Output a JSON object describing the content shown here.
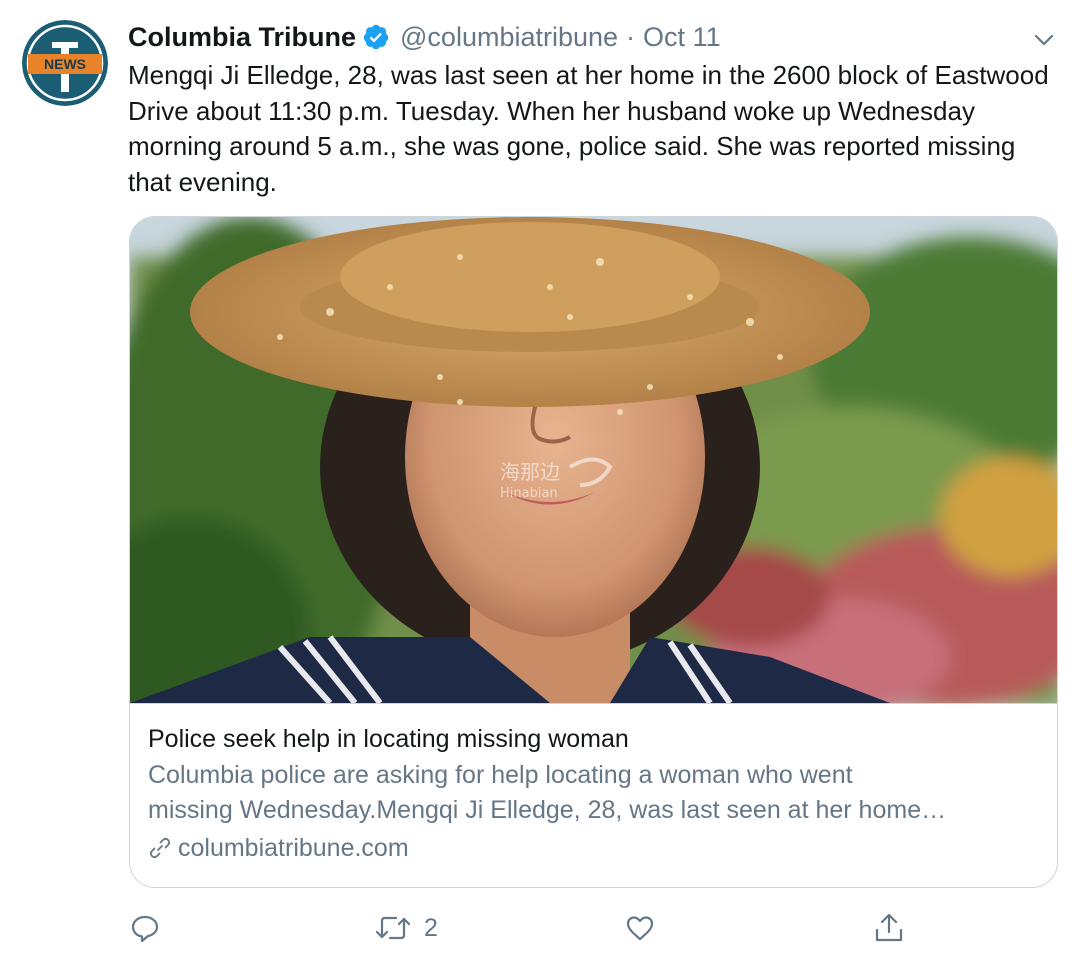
{
  "account": {
    "display_name": "Columbia Tribune",
    "handle": "@columbiatribune",
    "separator": "·",
    "date": "Oct 11",
    "avatar_text": "NEWS",
    "avatar_letter": "T"
  },
  "tweet": {
    "text": "Mengqi Ji Elledge, 28, was last seen at her home in the 2600 block of Eastwood Drive about 11:30 p.m. Tuesday. When her husband woke up Wednesday morning around 5 a.m., she was gone, police said. She was reported missing that evening."
  },
  "card": {
    "title": "Police seek help in locating missing woman",
    "description_line1": "Columbia police are asking for help locating a woman who went",
    "description_line2": "missing Wednesday.Mengqi Ji Elledge, 28, was last seen at her home…",
    "domain": "columbiatribune.com",
    "image_watermark_cn": "海那边",
    "image_watermark_en": "Hinabian"
  },
  "actions": {
    "reply_count": "",
    "retweet_count": "2",
    "like_count": "",
    "icons": [
      "reply-icon",
      "retweet-icon",
      "like-icon",
      "share-icon"
    ]
  },
  "colors": {
    "verified": "#1da1f2",
    "secondary_text": "#657786",
    "avatar_teal": "#1b5e73",
    "avatar_orange": "#e8832a"
  }
}
